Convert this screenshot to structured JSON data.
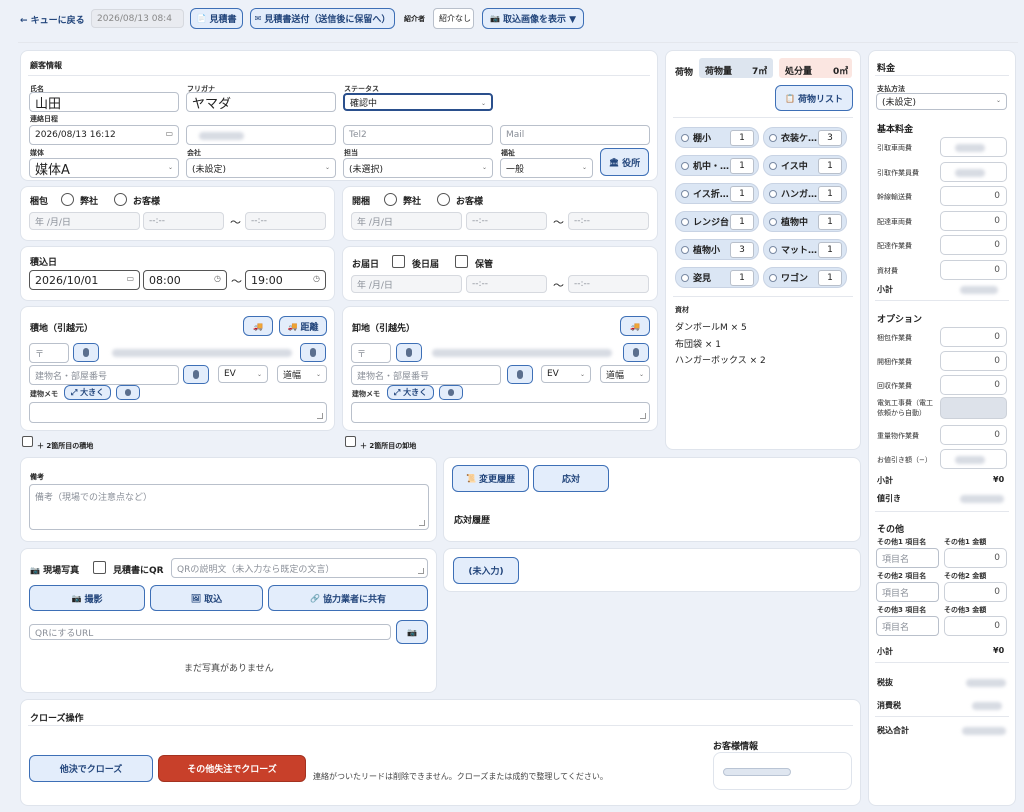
{
  "topbar": {
    "back": "← キューに戻る",
    "date": "2026/08/13 08:4",
    "estimate": "見積書",
    "send": "見積書送付（送信後に保留へ）",
    "referrer_label": "紹介者",
    "referrer_value": "紹介なし",
    "show_image": "取込画像を表示 ▼"
  },
  "customer": {
    "title": "顧客情報",
    "name_label": "氏名",
    "name_value": "山田",
    "kana_label": "フリガナ",
    "kana_value": "ヤマダ",
    "status_label": "ステータス",
    "status_value": "確認中",
    "contact_label": "連絡日程",
    "contact_value": "2026/08/13 16:12",
    "tel2": "Tel2",
    "mail": "Mail",
    "media_label": "媒体",
    "media_value": "媒体A",
    "company_label": "会社",
    "company_value": "(未設定)",
    "staff_label": "担当",
    "staff_value": "(未選択)",
    "welfare_label": "福祉",
    "welfare_value": "一般",
    "office_btn": "役所"
  },
  "packing": {
    "title": "梱包",
    "opt1": "弊社",
    "opt2": "お客様",
    "date_ph": "年 /月/日",
    "time_ph": "--:--",
    "tilde": "〜"
  },
  "unpacking": {
    "title": "開梱",
    "opt1": "弊社",
    "opt2": "お客様",
    "date_ph": "年 /月/日",
    "time_ph": "--:--",
    "tilde": "〜"
  },
  "loading": {
    "title": "積込日",
    "date": "2026/10/01",
    "from": "08:00",
    "to": "19:00",
    "tilde": "〜"
  },
  "delivery": {
    "title": "お届日",
    "opt1": "後日届",
    "opt2": "保管",
    "date_ph": "年 /月/日",
    "time_ph": "--:--",
    "tilde": "〜"
  },
  "origin": {
    "title": "積地（引越元）",
    "distance": "距離",
    "zip": "〒",
    "building_ph": "建物名・部屋番号",
    "ev": "EV",
    "road": "道幅",
    "memo_label": "建物メモ",
    "bigger": "⤢ 大きく",
    "add_second": "＋ 2箇所目の積地"
  },
  "dest": {
    "title": "卸地（引越先）",
    "zip": "〒",
    "building_ph": "建物名・部屋番号",
    "ev": "EV",
    "road": "道幅",
    "memo_label": "建物メモ",
    "bigger": "⤢ 大きく",
    "add_second": "＋ 2箇所目の卸地"
  },
  "notes": {
    "title": "備考",
    "placeholder": "備考（現場での注意点など）"
  },
  "history": {
    "change": "変更履歴",
    "response": "応対",
    "title": "応対履歴",
    "unentered": "(未入力)"
  },
  "photo": {
    "title": "現場写真",
    "qr_label": "見積書にQR",
    "qr_desc_ph": "QRの説明文（未入力なら既定の文言）",
    "shoot": "撮影",
    "import": "取込",
    "share": "協力業者に共有",
    "url_ph": "QRにするURL",
    "empty": "まだ写真がありません"
  },
  "close": {
    "title": "クローズ操作",
    "lost": "他決でクローズ",
    "other": "その他失注でクローズ",
    "note": "連絡がついたリードは削除できません。クローズまたは成約で整理してください。",
    "customer_info": "お客様情報"
  },
  "cargo": {
    "title": "荷物",
    "volume_label": "荷物量",
    "volume_value": "7㎥",
    "disposal_label": "処分量",
    "disposal_value": "0㎥",
    "list_btn": "荷物リスト",
    "items": [
      {
        "name": "棚小",
        "qty": "1"
      },
      {
        "name": "衣装ケ…",
        "qty": "3"
      },
      {
        "name": "机中・…",
        "qty": "1"
      },
      {
        "name": "イス中",
        "qty": "1"
      },
      {
        "name": "イス折…",
        "qty": "1"
      },
      {
        "name": "ハンガ…",
        "qty": "1"
      },
      {
        "name": "レンジ台",
        "qty": "1"
      },
      {
        "name": "植物中",
        "qty": "1"
      },
      {
        "name": "植物小",
        "qty": "3"
      },
      {
        "name": "マット…",
        "qty": "1"
      },
      {
        "name": "姿見",
        "qty": "1"
      },
      {
        "name": "ワゴン",
        "qty": "1"
      }
    ],
    "materials_label": "資材",
    "materials": [
      "ダンボールM × 5",
      "布団袋 × 1",
      "ハンガーボックス × 2"
    ]
  },
  "fee": {
    "title": "料金",
    "payment_label": "支払方法",
    "payment_value": "(未設定)",
    "basic_title": "基本料金",
    "basic": [
      {
        "label": "引取車両費",
        "value": ""
      },
      {
        "label": "引取作業員費",
        "value": ""
      },
      {
        "label": "幹線輸送費",
        "value": "0"
      },
      {
        "label": "配達車両費",
        "value": "0"
      },
      {
        "label": "配達作業費",
        "value": "0"
      },
      {
        "label": "資材費",
        "value": "0"
      }
    ],
    "subtotal": "小計",
    "option_title": "オプション",
    "options": [
      {
        "label": "梱包作業費",
        "value": "0"
      },
      {
        "label": "開梱作業費",
        "value": "0"
      },
      {
        "label": "回収作業費",
        "value": "0"
      },
      {
        "label": "電気工事費（電工依頼から自動）",
        "value": ""
      },
      {
        "label": "重量物作業費",
        "value": "0"
      },
      {
        "label": "お値引き額（−）",
        "value": ""
      }
    ],
    "opt_subtotal_value": "¥0",
    "discount": "値引き",
    "other_title": "その他",
    "others": [
      {
        "name_label": "その他1 項目名",
        "amt_label": "その他1 金額",
        "name_ph": "項目名",
        "amt": "0"
      },
      {
        "name_label": "その他2 項目名",
        "amt_label": "その他2 金額",
        "name_ph": "項目名",
        "amt": "0"
      },
      {
        "name_label": "その他3 項目名",
        "amt_label": "その他3 金額",
        "name_ph": "項目名",
        "amt": "0"
      }
    ],
    "other_subtotal_value": "¥0",
    "tax_ex": "税抜",
    "tax": "消費税",
    "total": "税込合計"
  }
}
